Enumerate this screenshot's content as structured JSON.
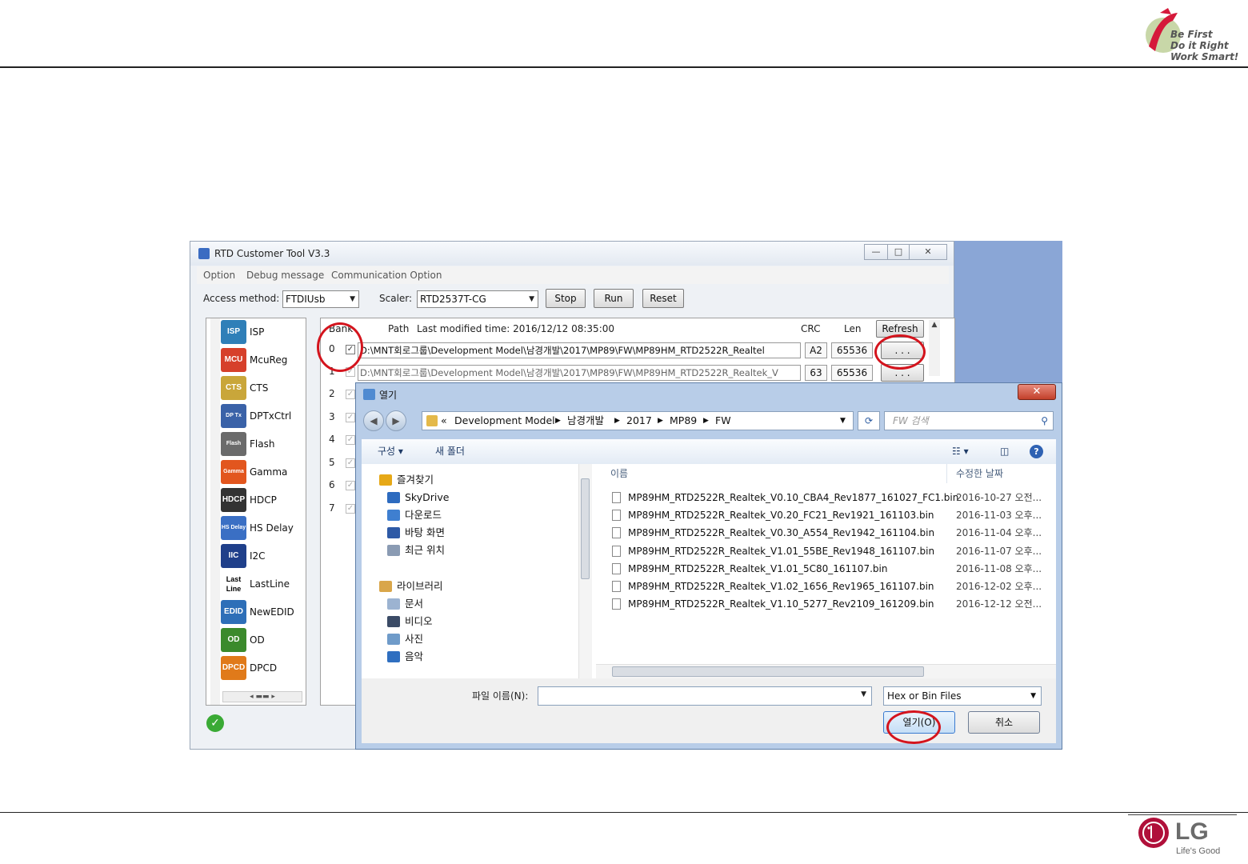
{
  "slide": {
    "slogan_lines": [
      "Be First",
      "Do it Right",
      "Work Smart!"
    ],
    "brand": "LG",
    "brand_tagline": "Life's Good"
  },
  "app": {
    "title": "RTD Customer Tool V3.3",
    "menu": [
      "Option",
      "Debug message",
      "Communication Option"
    ],
    "access_method_label": "Access method:",
    "access_method_value": "FTDIUsb",
    "scaler_label": "Scaler:",
    "scaler_value": "RTD2537T-CG",
    "buttons": {
      "stop": "Stop",
      "run": "Run",
      "reset": "Reset",
      "refresh": "Refresh",
      "browse": ". . ."
    },
    "sidebar_items": [
      {
        "label": "ISP",
        "icon": "isp-icon",
        "badge": "ISP",
        "color": "#2f7fb8"
      },
      {
        "label": "McuReg",
        "icon": "mcu-icon",
        "badge": "MCU",
        "color": "#d6402b"
      },
      {
        "label": "CTS",
        "icon": "cts-icon",
        "badge": "CTS",
        "color": "#c9a63a"
      },
      {
        "label": "DPTxCtrl",
        "icon": "dptx-icon",
        "badge": "DP Tx",
        "color": "#3a62a8"
      },
      {
        "label": "Flash",
        "icon": "flash-icon",
        "badge": "Flash",
        "color": "#6b6b6b"
      },
      {
        "label": "Gamma",
        "icon": "gamma-icon",
        "badge": "Gamma",
        "color": "#e2561e"
      },
      {
        "label": "HDCP",
        "icon": "hdcp-icon",
        "badge": "HDCP",
        "color": "#333333"
      },
      {
        "label": "HS Delay",
        "icon": "hs-delay-icon",
        "badge": "HS Delay",
        "color": "#3a6fc4"
      },
      {
        "label": "I2C",
        "icon": "i2c-icon",
        "badge": "IIC",
        "color": "#1f3f8a"
      },
      {
        "label": "LastLine",
        "icon": "lastline-icon",
        "badge": "Last Line",
        "color": "#ffffff"
      },
      {
        "label": "NewEDID",
        "icon": "edid-icon",
        "badge": "EDID",
        "color": "#2e6fb8"
      },
      {
        "label": "OD",
        "icon": "od-icon",
        "badge": "OD",
        "color": "#3b8a2c"
      },
      {
        "label": "DPCD",
        "icon": "dpcd-icon",
        "badge": "DPCD",
        "color": "#e07a1a"
      }
    ],
    "table_headers": {
      "bank": "Bank",
      "path": "Path",
      "modified": "Last modified time: 2016/12/12 08:35:00",
      "crc": "CRC",
      "len": "Len"
    },
    "rows": [
      {
        "bank": "0",
        "path": "D:\\MNT회로그룹\\Development Model\\남경개발\\2017\\MP89\\FW\\MP89HM_RTD2522R_Realtel",
        "crc": "A2",
        "len": "65536"
      },
      {
        "bank": "1",
        "path": "D:\\MNT회로그룹\\Development Model\\남경개발\\2017\\MP89\\FW\\MP89HM_RTD2522R_Realtek_V",
        "crc": "63",
        "len": "65536"
      }
    ],
    "bank_numbers": [
      "2",
      "3",
      "4",
      "5",
      "6",
      "7"
    ]
  },
  "dialog": {
    "title": "열기",
    "breadcrumb": [
      "Development Model",
      "남경개발",
      "2017",
      "MP89",
      "FW"
    ],
    "breadcrumb_prefix": "«",
    "search_placeholder": "FW 검색",
    "toolbar": {
      "organize": "구성 ▾",
      "new_folder": "새 폴더"
    },
    "nav_tree": [
      {
        "label": "즐겨찾기",
        "color": "#e6a817",
        "indent": 0
      },
      {
        "label": "SkyDrive",
        "color": "#2d6bbf",
        "indent": 1
      },
      {
        "label": "다운로드",
        "color": "#3f7fd0",
        "indent": 1
      },
      {
        "label": "바탕 화면",
        "color": "#2e5aa6",
        "indent": 1
      },
      {
        "label": "최근 위치",
        "color": "#8a9bb3",
        "indent": 1
      },
      {
        "label": "라이브러리",
        "color": "#d9a64a",
        "indent": 0
      },
      {
        "label": "문서",
        "color": "#9cb3d1",
        "indent": 1
      },
      {
        "label": "비디오",
        "color": "#3b4b66",
        "indent": 1
      },
      {
        "label": "사진",
        "color": "#6f9bc9",
        "indent": 1
      },
      {
        "label": "음악",
        "color": "#2f6fc0",
        "indent": 1
      }
    ],
    "columns": {
      "name": "이름",
      "modified": "수정한 날짜"
    },
    "files": [
      {
        "name": "MP89HM_RTD2522R_Realtek_V0.10_CBA4_Rev1877_161027_FC1.bin",
        "date": "2016-10-27 오전..."
      },
      {
        "name": "MP89HM_RTD2522R_Realtek_V0.20_FC21_Rev1921_161103.bin",
        "date": "2016-11-03 오후..."
      },
      {
        "name": "MP89HM_RTD2522R_Realtek_V0.30_A554_Rev1942_161104.bin",
        "date": "2016-11-04 오후..."
      },
      {
        "name": "MP89HM_RTD2522R_Realtek_V1.01_55BE_Rev1948_161107.bin",
        "date": "2016-11-07 오후..."
      },
      {
        "name": "MP89HM_RTD2522R_Realtek_V1.01_5C80_161107.bin",
        "date": "2016-11-08 오후..."
      },
      {
        "name": "MP89HM_RTD2522R_Realtek_V1.02_1656_Rev1965_161107.bin",
        "date": "2016-12-02 오후..."
      },
      {
        "name": "MP89HM_RTD2522R_Realtek_V1.10_5277_Rev2109_161209.bin",
        "date": "2016-12-12 오전..."
      }
    ],
    "filename_label": "파일 이름(N):",
    "filename_value": "",
    "filetype_value": "Hex or Bin Files",
    "open_button": "열기(O)",
    "cancel_button": "취소"
  }
}
